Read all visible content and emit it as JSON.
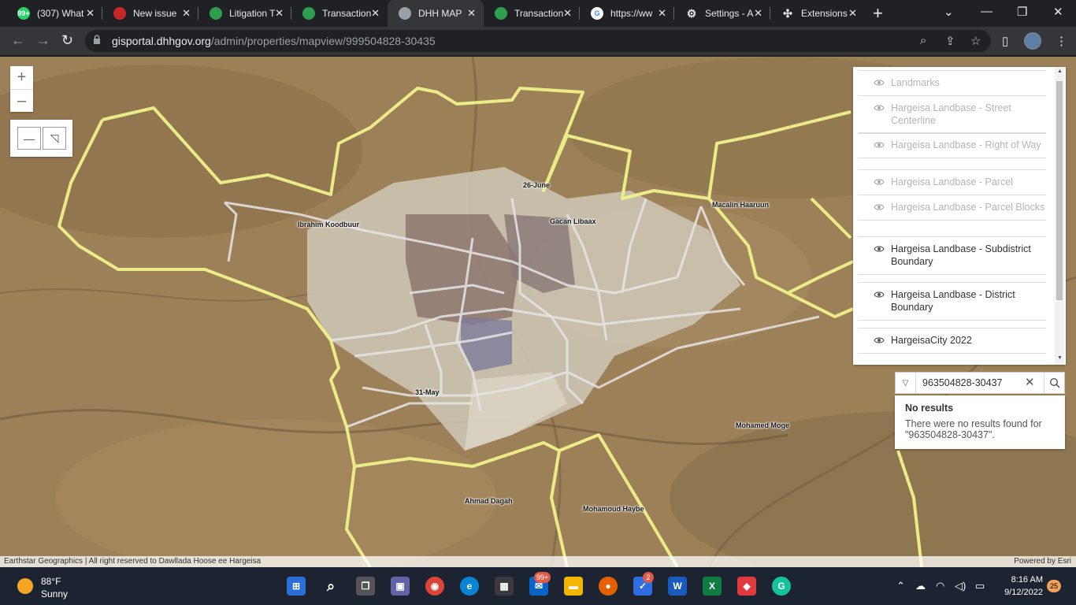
{
  "browser": {
    "tabs": [
      {
        "label": "(307) What",
        "favicon_color": "#25d366",
        "favicon_text": "99+"
      },
      {
        "label": "New issue",
        "favicon_color": "#c62828",
        "favicon_text": ""
      },
      {
        "label": "Litigation T",
        "favicon_color": "#2e9e4f",
        "favicon_text": ""
      },
      {
        "label": "Transaction",
        "favicon_color": "#2e9e4f",
        "favicon_text": ""
      },
      {
        "label": "DHH MAP",
        "favicon_color": "#9aa0a6",
        "favicon_text": "",
        "active": true
      },
      {
        "label": "Transaction",
        "favicon_color": "#2e9e4f",
        "favicon_text": ""
      },
      {
        "label": "https://ww",
        "favicon_color": "#ffffff",
        "favicon_text": "G"
      },
      {
        "label": "Settings - A",
        "favicon_color": "#9aa0a6",
        "favicon_text": ""
      },
      {
        "label": "Extensions",
        "favicon_color": "#9aa0a6",
        "favicon_text": ""
      }
    ],
    "url_host": "gisportal.dhhgov.org",
    "url_path": "/admin/properties/mapview/999504828-30435"
  },
  "map": {
    "places": [
      {
        "label": "26-June"
      },
      {
        "label": "Gacan Libaax"
      },
      {
        "label": "Macalin Haaruun"
      },
      {
        "label": "Ibrahim Koodbuur"
      },
      {
        "label": "31-May"
      },
      {
        "label": "Mohamed Moge"
      },
      {
        "label": "Ahmad Dagah"
      },
      {
        "label": "Mohamoud Haybe"
      }
    ],
    "attribution": "Earthstar Geographics | All right reserved to Dawllada Hoose ee Hargeisa",
    "powered_by": "Powered by Esri"
  },
  "layers": [
    {
      "label": "Landmarks",
      "visible": false
    },
    {
      "label": "Hargeisa Landbase - Street Centerline",
      "visible": false
    },
    {
      "label": "Hargeisa Landbase - Right of Way",
      "visible": false
    },
    {
      "label": "Hargeisa Landbase - Parcel",
      "visible": false
    },
    {
      "label": "Hargeisa Landbase - Parcel Blocks",
      "visible": false
    },
    {
      "label": "Hargeisa Landbase - Subdistrict Boundary",
      "visible": true
    },
    {
      "label": "Hargeisa Landbase - District Boundary",
      "visible": true
    },
    {
      "label": "HargeisaCity 2022",
      "visible": true
    }
  ],
  "search": {
    "value": "963504828-30437",
    "result_title": "No results",
    "result_body": "There were no results found for \"963504828-30437\"."
  },
  "taskbar": {
    "temperature": "88°F",
    "condition": "Sunny",
    "mail_badge": "99+",
    "todo_badge": "2",
    "time": "8:16 AM",
    "date": "9/12/2022",
    "notifications": "25"
  }
}
